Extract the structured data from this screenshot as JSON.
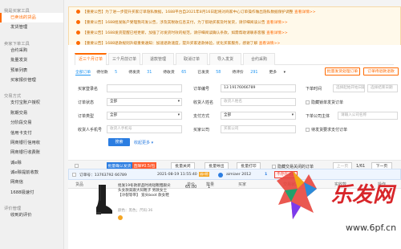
{
  "sidebar": {
    "groups": [
      {
        "title": "我是买家工具",
        "items": [
          {
            "label": "已卖出的货品",
            "active": true
          },
          {
            "label": "发货管理",
            "active": false
          }
        ]
      },
      {
        "title": "卖家下单工具",
        "items": [
          {
            "label": "合约采购",
            "active": false
          },
          {
            "label": "批量发货",
            "active": false
          },
          {
            "label": "预单列表",
            "active": false
          },
          {
            "label": "买家报价管理",
            "active": false
          }
        ]
      },
      {
        "title": "交易方式",
        "items": [
          {
            "label": "支付宝账户授权",
            "active": false
          },
          {
            "label": "账期交易",
            "active": false
          },
          {
            "label": "分阶段交易",
            "active": false
          },
          {
            "label": "信用卡支付",
            "active": false
          },
          {
            "label": "网商银行信用收",
            "active": false
          },
          {
            "label": "网商银行收费账",
            "active": false
          },
          {
            "label": "诚e赊",
            "active": false
          },
          {
            "label": "诚e赊提前收款",
            "active": false
          },
          {
            "label": "网商信",
            "active": false
          },
          {
            "label": "1688极速付",
            "active": false
          }
        ]
      },
      {
        "title": "评价管理",
        "items": [
          {
            "label": "收到的评价",
            "active": false
          }
        ]
      }
    ]
  },
  "notices": [
    {
      "text": "【重要公告】为了进一步提升买家订单隐私数据，1688平台自2021年8月16日起将对商家中心订单操作做出隐私数据保护调整",
      "link": "查看详情>>"
    },
    {
      "text": "【重要公告】1688批发账户受理我司发公告，涉及其税收信息支付，为了帮助买家及时发货，请仔细阅读公告",
      "link": "查看详情>>"
    },
    {
      "text": "【重要公告】1688发货提醒已经更新，加强了对发货时效的规范，请仔细阅读确认条款，如需帮助请联系客服",
      "link": "查看详情>>"
    },
    {
      "text": "【重要公告】1688退款规则升级重要通知：加速退款速度，提升买家退款体验，优化买家服务，感谢了解",
      "link": "查看详情>>"
    }
  ],
  "tabs": [
    {
      "label": "近三个月订单",
      "active": true
    },
    {
      "label": "三个月前订单",
      "active": false
    },
    {
      "label": "退款管理",
      "active": false
    },
    {
      "label": "取消订单",
      "active": false
    },
    {
      "label": "导入发货",
      "active": false
    },
    {
      "label": "合约采购",
      "active": false
    }
  ],
  "top_buttons": {
    "batch_send": "批量发货处理订单",
    "batch_refund": "订单待退款退款"
  },
  "counts": [
    {
      "label": "全部订单",
      "num": "",
      "selected": true
    },
    {
      "label": "待付款",
      "num": "5",
      "selected": false
    },
    {
      "label": "待发货",
      "num": "31",
      "selected": false
    },
    {
      "label": "待收货",
      "num": "65",
      "selected": false
    },
    {
      "label": "已发货",
      "num": "58",
      "selected": false
    },
    {
      "label": "待评价",
      "num": "291",
      "selected": false
    },
    {
      "label": "更多",
      "num": "",
      "selected": false
    }
  ],
  "filters": {
    "buyer_name_label": "买家登录名",
    "buyer_name_ph": "",
    "order_no_label": "订单编号",
    "order_no_value": "13 19176066789",
    "order_time_label": "下单时间",
    "order_time_start": "选择起始开始日期",
    "order_time_end": "选择结束日期",
    "order_status_label": "订单状态",
    "order_status_value": "全部",
    "receiver_label": "收货人姓名",
    "receiver_ph": "收货人姓名",
    "lock_label": "隐藏锁单发货订单",
    "order_type_label": "订单类型",
    "order_type_value": "全部",
    "pay_label": "支付方式",
    "pay_value": "全部",
    "company_label": "下单公司主体",
    "company_ph": "请输入公司名称",
    "phone_label": "收货人手机号",
    "phone_ph": "收货人手机号",
    "buyer_co_label": "买家公司",
    "buyer_co_ph": "买家公司",
    "debt_label": "待发货要求支付订单",
    "search": "搜索",
    "expand": "收起更多"
  },
  "toolbar": {
    "batch_pay": "批量确认发货",
    "badge": "直降¥0.5/包",
    "batch_close": "批量关闭",
    "batch_export": "批量导出",
    "batch_print": "批量打印",
    "hide_closed": "隐藏交易关闭的订单",
    "prev": "上一页",
    "page": "1/61",
    "next": "下一页"
  },
  "table_head": {
    "product": "货品",
    "price": "单价",
    "qty": "数量",
    "buyer": "买家",
    "status": "交易状态",
    "amount": "实收款",
    "ops": "操作"
  },
  "order": {
    "number": "订单号：13763792 66789",
    "time": "2021-08-19 11:55:40",
    "tag": "诚e赊",
    "buyer": "aimiaer 2012",
    "flag": "1",
    "badge": "不存在退货",
    "product_title": "批发19冬款新品时尚短靴粗跟尖头女款高跟大码靴子 男款女士 【冷裂等带】 宽头boot  款女鞋",
    "spec": "颜色：黑色；尺码:36",
    "price": "65.00",
    "qty": "1"
  },
  "watermark": {
    "text": "乐发网",
    "url": "www.6pf.cn"
  }
}
